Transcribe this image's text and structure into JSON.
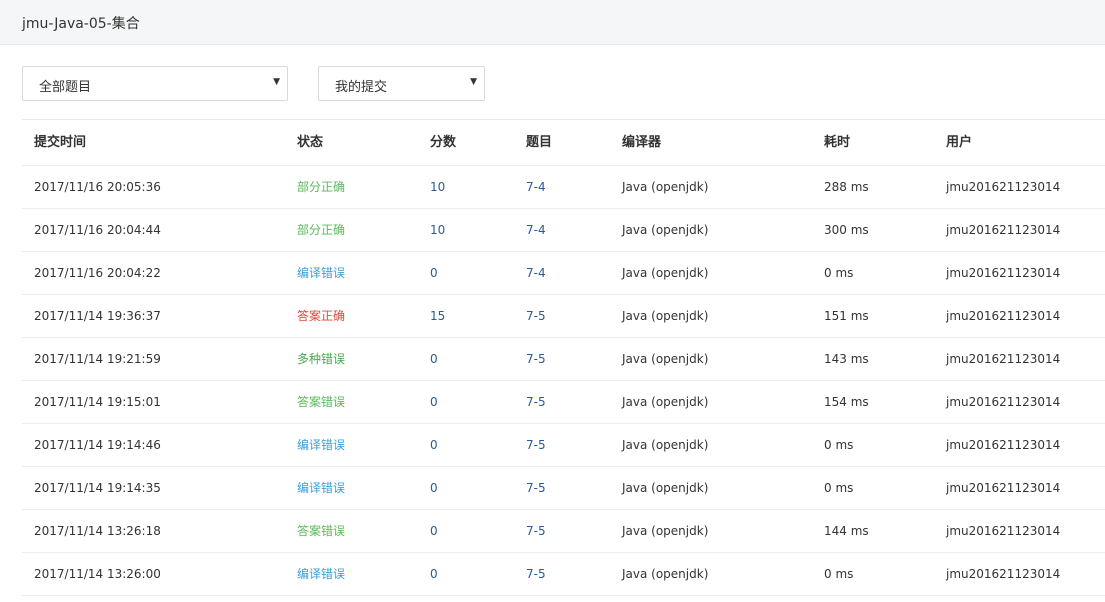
{
  "header": {
    "title": "jmu-Java-05-集合"
  },
  "filters": {
    "problem": {
      "value": "全部题目"
    },
    "submitter": {
      "value": "我的提交"
    },
    "caret": "▼"
  },
  "table": {
    "columns": {
      "time": "提交时间",
      "status": "状态",
      "score": "分数",
      "problem": "题目",
      "compiler": "编译器",
      "elapsed": "耗时",
      "user": "用户"
    },
    "rows": [
      {
        "time": "2017/11/16 20:05:36",
        "status": "部分正确",
        "status_kind": "partial",
        "score": "10",
        "problem": "7-4",
        "compiler": "Java (openjdk)",
        "elapsed": "288 ms",
        "user": "jmu201621123014"
      },
      {
        "time": "2017/11/16 20:04:44",
        "status": "部分正确",
        "status_kind": "partial",
        "score": "10",
        "problem": "7-4",
        "compiler": "Java (openjdk)",
        "elapsed": "300 ms",
        "user": "jmu201621123014"
      },
      {
        "time": "2017/11/16 20:04:22",
        "status": "编译错误",
        "status_kind": "compile",
        "score": "0",
        "problem": "7-4",
        "compiler": "Java (openjdk)",
        "elapsed": "0 ms",
        "user": "jmu201621123014"
      },
      {
        "time": "2017/11/14 19:36:37",
        "status": "答案正确",
        "status_kind": "accept",
        "score": "15",
        "problem": "7-5",
        "compiler": "Java (openjdk)",
        "elapsed": "151 ms",
        "user": "jmu201621123014"
      },
      {
        "time": "2017/11/14 19:21:59",
        "status": "多种错误",
        "status_kind": "multi",
        "score": "0",
        "problem": "7-5",
        "compiler": "Java (openjdk)",
        "elapsed": "143 ms",
        "user": "jmu201621123014"
      },
      {
        "time": "2017/11/14 19:15:01",
        "status": "答案错误",
        "status_kind": "wrong",
        "score": "0",
        "problem": "7-5",
        "compiler": "Java (openjdk)",
        "elapsed": "154 ms",
        "user": "jmu201621123014"
      },
      {
        "time": "2017/11/14 19:14:46",
        "status": "编译错误",
        "status_kind": "compile",
        "score": "0",
        "problem": "7-5",
        "compiler": "Java (openjdk)",
        "elapsed": "0 ms",
        "user": "jmu201621123014"
      },
      {
        "time": "2017/11/14 19:14:35",
        "status": "编译错误",
        "status_kind": "compile",
        "score": "0",
        "problem": "7-5",
        "compiler": "Java (openjdk)",
        "elapsed": "0 ms",
        "user": "jmu201621123014"
      },
      {
        "time": "2017/11/14 13:26:18",
        "status": "答案错误",
        "status_kind": "wrong",
        "score": "0",
        "problem": "7-5",
        "compiler": "Java (openjdk)",
        "elapsed": "144 ms",
        "user": "jmu201621123014"
      },
      {
        "time": "2017/11/14 13:26:00",
        "status": "编译错误",
        "status_kind": "compile",
        "score": "0",
        "problem": "7-5",
        "compiler": "Java (openjdk)",
        "elapsed": "0 ms",
        "user": "jmu201621123014"
      }
    ]
  },
  "colors": {
    "partial": "#5cb85c",
    "compile": "#3ba0d6",
    "accept": "#e0463c",
    "multi": "#4aa84f",
    "wrong": "#5cb85c",
    "link": "#2a5b94"
  }
}
